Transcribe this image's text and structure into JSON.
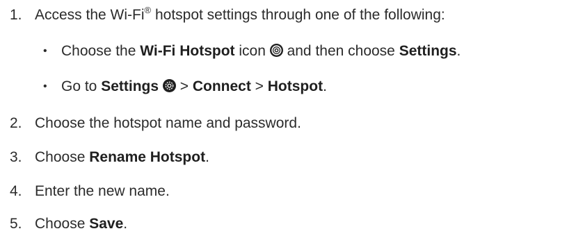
{
  "steps": [
    {
      "number": "1.",
      "text_a": "Access the Wi-Fi",
      "reg": "®",
      "text_b": " hotspot settings through one of the following:"
    },
    {
      "number": "2.",
      "text": "Choose the hotspot name and password."
    },
    {
      "number": "3.",
      "pre": "Choose ",
      "bold": "Rename Hotspot",
      "post": "."
    },
    {
      "number": "4.",
      "text": "Enter the new name."
    },
    {
      "number": "5.",
      "pre": "Choose ",
      "bold": "Save",
      "post": "."
    }
  ],
  "substeps": [
    {
      "bullet": "•",
      "t1": "Choose the ",
      "b1": "Wi-Fi Hotspot",
      "t2": " icon ",
      "t3": " and then choose ",
      "b2": "Settings",
      "t4": "."
    },
    {
      "bullet": "•",
      "t1": "Go to ",
      "b1": "Settings",
      "t2": " > ",
      "b2": "Connect",
      "t3": " > ",
      "b3": "Hotspot",
      "t4": "."
    }
  ],
  "icons": {
    "hotspot": "wifi-hotspot-icon",
    "settings": "settings-gear-icon",
    "color": "#1f1f1f"
  }
}
